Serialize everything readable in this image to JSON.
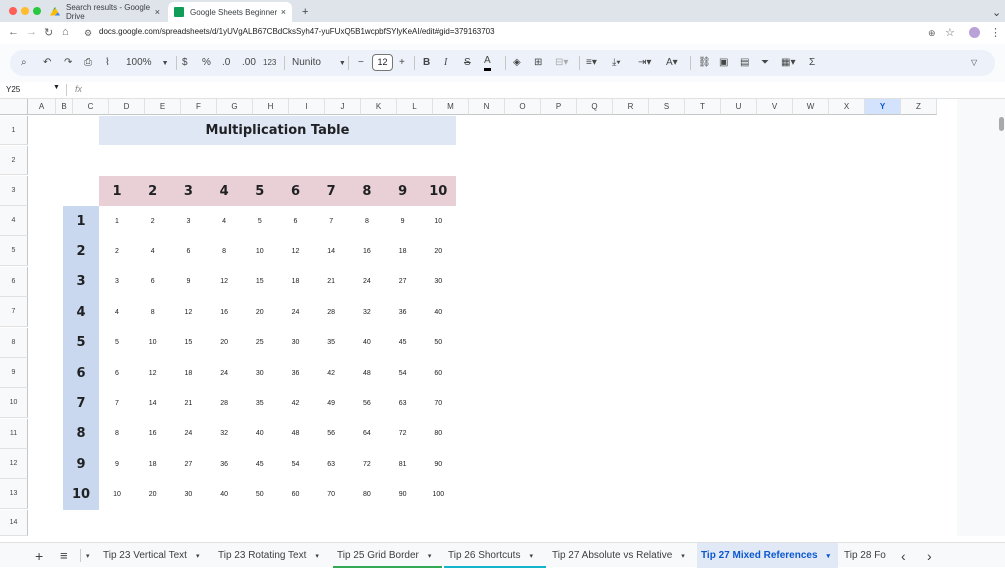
{
  "browser": {
    "tabs": [
      {
        "title": "Search results - Google Drive",
        "close": "×"
      },
      {
        "title": "Google Sheets Beginner Full Co",
        "close": "×"
      }
    ],
    "new_tab": "+",
    "menu": "⌄",
    "url": "docs.google.com/spreadsheets/d/1yUVgALB67CBdCksSyh47-yuFUxQ5B1wcpbfSYlyKeAI/edit#gid=379163703"
  },
  "toolbar": {
    "zoom": "100%",
    "currency": "$",
    "percent": "%",
    "dec_down": ".0",
    "dec_up": ".00",
    "number_format": "123",
    "font": "Nunito",
    "font_size": "12",
    "minus": "−",
    "plus": "+",
    "bold": "B",
    "italic": "I",
    "strike": "S",
    "text_color_glyph": "A",
    "sum": "Σ"
  },
  "formula": {
    "cell_ref": "Y25",
    "fx": "fx"
  },
  "grid": {
    "columns": [
      "A",
      "B",
      "C",
      "D",
      "E",
      "F",
      "G",
      "H",
      "I",
      "J",
      "K",
      "L",
      "M",
      "N",
      "O",
      "P",
      "Q",
      "R",
      "S",
      "T",
      "U",
      "V",
      "W",
      "X",
      "Y",
      "Z"
    ],
    "selected_column": "Y",
    "rows": [
      "1",
      "2",
      "3",
      "4",
      "5",
      "6",
      "7",
      "8",
      "9",
      "10",
      "11",
      "12",
      "13",
      "14"
    ]
  },
  "table": {
    "title": "Multiplication Table",
    "col_headers": [
      "1",
      "2",
      "3",
      "4",
      "5",
      "6",
      "7",
      "8",
      "9",
      "10"
    ],
    "row_headers": [
      "1",
      "2",
      "3",
      "4",
      "5",
      "6",
      "7",
      "8",
      "9",
      "10"
    ],
    "rows": [
      [
        "1",
        "2",
        "3",
        "4",
        "5",
        "6",
        "7",
        "8",
        "9",
        "10"
      ],
      [
        "2",
        "4",
        "6",
        "8",
        "10",
        "12",
        "14",
        "16",
        "18",
        "20"
      ],
      [
        "3",
        "6",
        "9",
        "12",
        "15",
        "18",
        "21",
        "24",
        "27",
        "30"
      ],
      [
        "4",
        "8",
        "12",
        "16",
        "20",
        "24",
        "28",
        "32",
        "36",
        "40"
      ],
      [
        "5",
        "10",
        "15",
        "20",
        "25",
        "30",
        "35",
        "40",
        "45",
        "50"
      ],
      [
        "6",
        "12",
        "18",
        "24",
        "30",
        "36",
        "42",
        "48",
        "54",
        "60"
      ],
      [
        "7",
        "14",
        "21",
        "28",
        "35",
        "42",
        "49",
        "56",
        "63",
        "70"
      ],
      [
        "8",
        "16",
        "24",
        "32",
        "40",
        "48",
        "56",
        "64",
        "72",
        "80"
      ],
      [
        "9",
        "18",
        "27",
        "36",
        "45",
        "54",
        "63",
        "72",
        "81",
        "90"
      ],
      [
        "10",
        "20",
        "30",
        "40",
        "50",
        "60",
        "70",
        "80",
        "90",
        "100"
      ]
    ],
    "colors": {
      "title_bg": "#e0e7f4",
      "header_bg": "#e9d0d6",
      "row_header_bg": "#c9d8ee"
    }
  },
  "sheets": {
    "add": "+",
    "list": "≡",
    "tabs": [
      {
        "label": "Tip 23 Vertical Text",
        "caret": "▾"
      },
      {
        "label": "Tip 23 Rotating Text",
        "caret": "▾"
      },
      {
        "label": "Tip 25 Grid Border",
        "caret": "▾"
      },
      {
        "label": "Tip 26 Shortcuts",
        "caret": "▾"
      },
      {
        "label": "Tip 27 Absolute vs Relative",
        "caret": "▾"
      },
      {
        "label": "Tip 27 Mixed References",
        "caret": "▾"
      },
      {
        "label": "Tip 28 Fo",
        "caret": ""
      }
    ],
    "prev": "‹",
    "next": "›",
    "underline_colors": {
      "grid_border": "#34a853",
      "shortcuts": "#12b5cb"
    }
  }
}
